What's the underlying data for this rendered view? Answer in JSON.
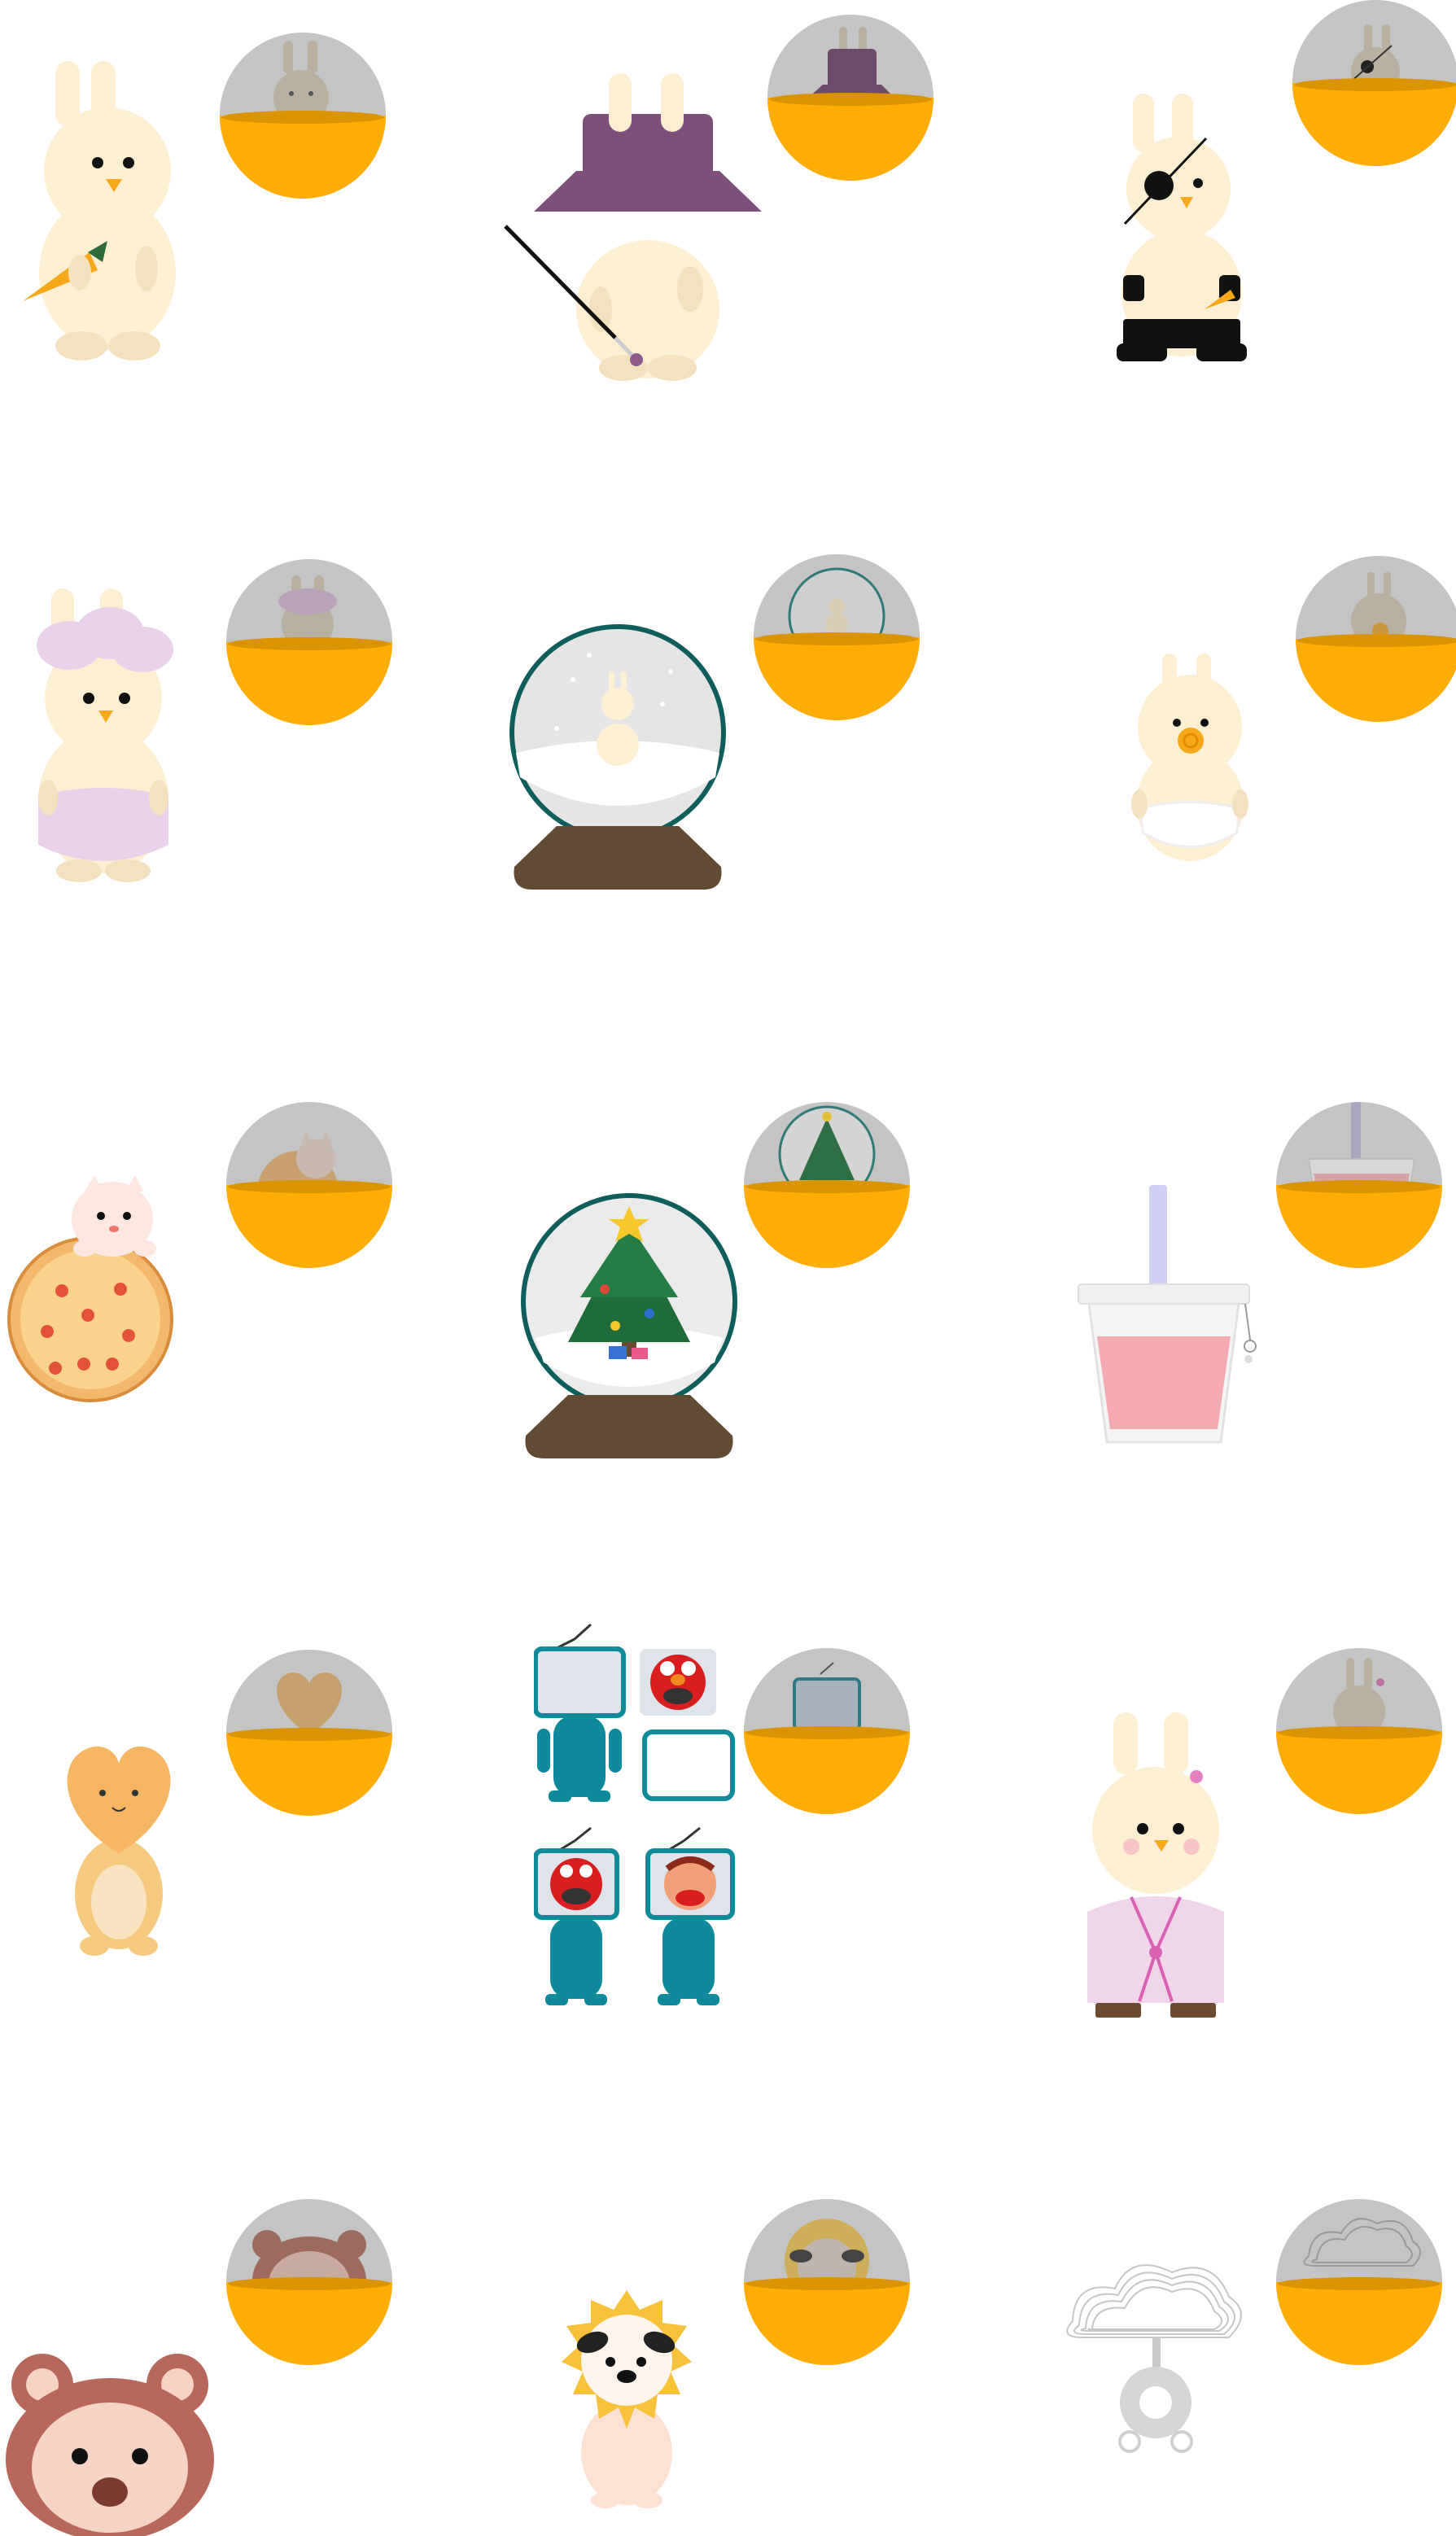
{
  "gallery": {
    "colors": {
      "background": "#ffffff",
      "capsule_top": "#c4c4c4",
      "capsule_bottom": "#ffad05",
      "capsule_rim": "#d99400",
      "bunny_fur": "#fdefd1",
      "beak": "#f7a81b"
    },
    "items": [
      {
        "name": "carrot-bunny",
        "icon": "bunny-with-carrot-icon"
      },
      {
        "name": "magician-bunny",
        "icon": "bunny-with-purple-hat-and-wand-icon"
      },
      {
        "name": "pirate-bunny",
        "icon": "bunny-with-eyepatch-icon"
      },
      {
        "name": "diaper-bunny",
        "icon": "bunny-with-pink-cloud-hair-icon"
      },
      {
        "name": "snowman-globe",
        "icon": "snow-globe-with-snowman-icon"
      },
      {
        "name": "pacifier-chick",
        "icon": "bunny-with-pacifier-icon"
      },
      {
        "name": "pizza-cat",
        "icon": "cat-with-pizza-icon"
      },
      {
        "name": "christmas-globe",
        "icon": "snow-globe-with-christmas-tree-icon"
      },
      {
        "name": "strawberry-drink",
        "icon": "pink-drink-cup-icon"
      },
      {
        "name": "heart-cat",
        "icon": "heart-head-cat-icon"
      },
      {
        "name": "tv-head-set",
        "icon": "tv-head-figures-icon"
      },
      {
        "name": "kimono-bunny",
        "icon": "bunny-in-pink-robe-icon"
      },
      {
        "name": "bear-head",
        "icon": "bear-head-icon"
      },
      {
        "name": "sun-dog",
        "icon": "sun-mane-dog-icon"
      },
      {
        "name": "cloud-spring",
        "icon": "cloud-slinky-icon"
      }
    ]
  }
}
